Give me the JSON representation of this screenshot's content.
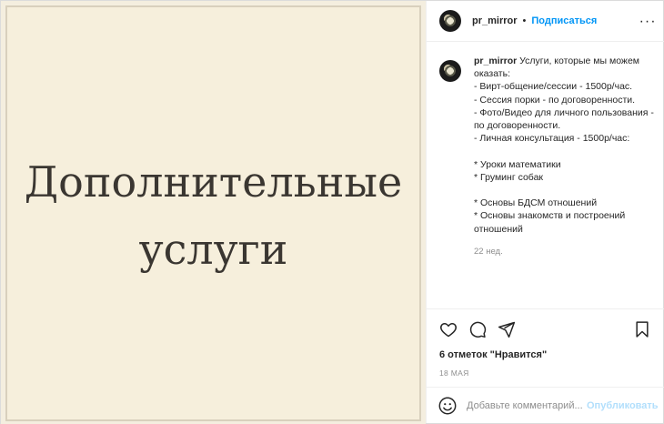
{
  "media": {
    "line1": "Дополнительные",
    "line2": "услуги"
  },
  "header": {
    "username": "pr_mirror",
    "separator": "•",
    "follow_label": "Подписаться",
    "more_label": "···"
  },
  "caption": {
    "username": "pr_mirror",
    "text": " Услуги, которые мы можем оказать:\n- Вирт-общение/сессии - 1500р/час.\n- Сессия порки - по договоренности.\n- Фото/Видео для личного пользования - по договоренности.\n- Личная консультация - 1500р/час:\n\n* Уроки математики\n* Груминг собак\n\n* Основы БДСМ отношений\n* Основы знакомств и построений отношений",
    "time": "22 нед."
  },
  "actions": {
    "icons": [
      "heart-icon",
      "comment-icon",
      "share-icon",
      "bookmark-icon"
    ]
  },
  "likes": "6 отметок \"Нравится\"",
  "date": "18 МАЯ",
  "add_comment": {
    "placeholder": "Добавьте комментарий...",
    "publish_label": "Опубликовать"
  },
  "colors": {
    "accent": "#0095f6",
    "publish_disabled": "#b2dffc",
    "media_bg": "#f6efdc",
    "media_text": "#3a3631"
  }
}
